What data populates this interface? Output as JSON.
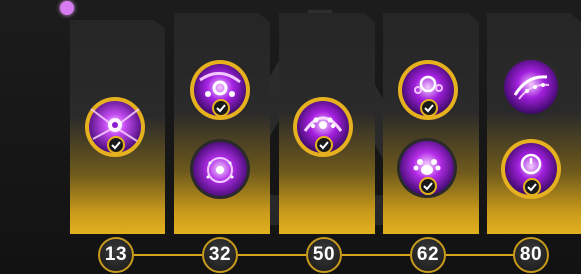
{
  "levels": [
    {
      "label": "13"
    },
    {
      "label": "32"
    },
    {
      "label": "50"
    },
    {
      "label": "62"
    },
    {
      "label": "80"
    }
  ],
  "skills": [
    {
      "icon": "burst-eye-skill-icon",
      "unlocked": true
    },
    {
      "icon": "nodes-skill-icon",
      "unlocked": true
    },
    {
      "icon": "orb-ring-skill-icon",
      "unlocked": true
    },
    {
      "icon": "paw-shield-skill-icon",
      "unlocked": true
    },
    {
      "icon": "bubble-orb-skill-icon",
      "unlocked": true
    },
    {
      "icon": "paw-orb-skill-icon",
      "unlocked": true
    },
    {
      "icon": "grip-claw-skill-icon",
      "unlocked": false
    },
    {
      "icon": "timer-skill-icon",
      "unlocked": true
    }
  ],
  "colors": {
    "gold": "#e2b01f",
    "purple": "#a61fe0",
    "accent_dot": "#d67bf0"
  }
}
